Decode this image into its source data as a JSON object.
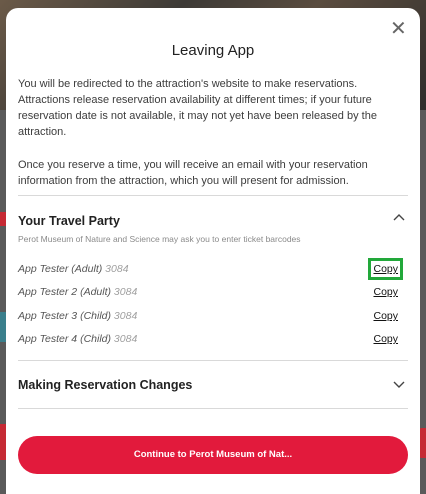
{
  "modal": {
    "title": "Leaving App",
    "close_icon": "close-icon",
    "paragraph1": "You will be redirected to the attraction's website to make reservations. Attractions release reservation availability at different times; if your future reservation date is not available, it may not yet have been released by the attraction.",
    "paragraph2": "Once you reserve a time, you will receive an email with your reservation information from the attraction, which you will present for admission."
  },
  "travel_party": {
    "title": "Your Travel Party",
    "subtitle": "Perot Museum of Nature and Science may ask you to enter ticket barcodes",
    "expanded": true,
    "members": [
      {
        "name": "App Tester (Adult)",
        "code": "3084",
        "copy_label": "Copy"
      },
      {
        "name": "App Tester 2 (Adult)",
        "code": "3084",
        "copy_label": "Copy"
      },
      {
        "name": "App Tester 3 (Child)",
        "code": "3084",
        "copy_label": "Copy"
      },
      {
        "name": "App Tester 4 (Child)",
        "code": "3084",
        "copy_label": "Copy"
      }
    ]
  },
  "reservation_changes": {
    "title": "Making Reservation Changes",
    "expanded": false
  },
  "cta": {
    "label": "Continue to Perot Museum of Nat..."
  },
  "colors": {
    "accent": "#e21a3c",
    "focus": "#22a83a"
  }
}
